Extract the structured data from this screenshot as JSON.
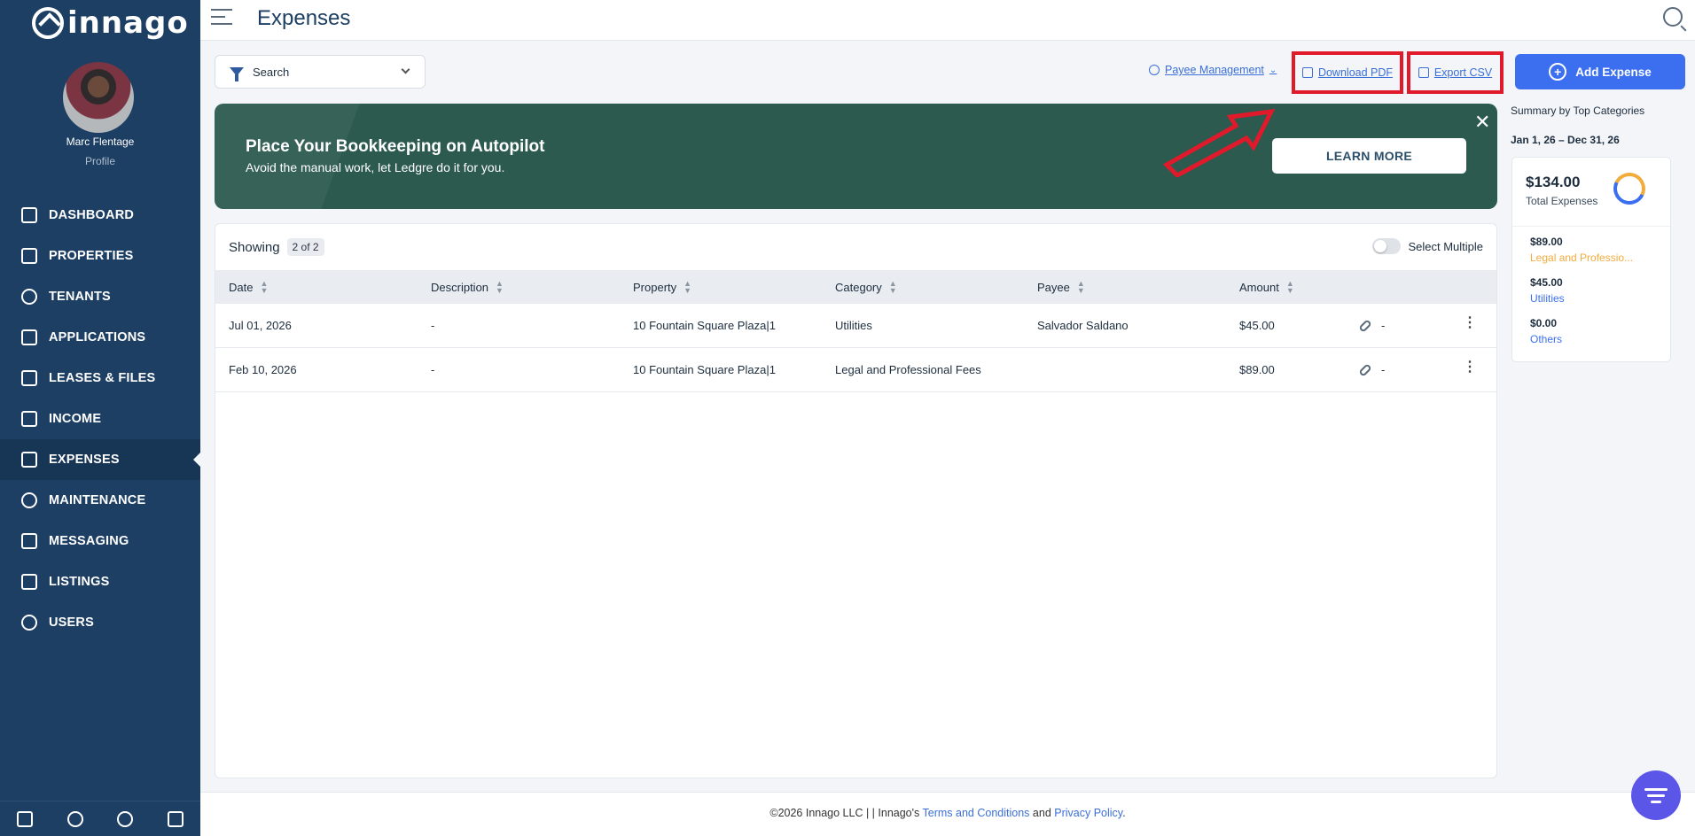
{
  "brand": {
    "name": "innago"
  },
  "user": {
    "name": "Marc Flentage",
    "profile_label": "Profile"
  },
  "sidebar": {
    "items": [
      {
        "label": "DASHBOARD",
        "icon": "dashboard-icon"
      },
      {
        "label": "PROPERTIES",
        "icon": "building-icon"
      },
      {
        "label": "TENANTS",
        "icon": "people-icon"
      },
      {
        "label": "APPLICATIONS",
        "icon": "application-icon"
      },
      {
        "label": "LEASES & FILES",
        "icon": "document-icon"
      },
      {
        "label": "INCOME",
        "icon": "income-icon"
      },
      {
        "label": "EXPENSES",
        "icon": "wallet-icon",
        "active": true
      },
      {
        "label": "MAINTENANCE",
        "icon": "wrench-icon"
      },
      {
        "label": "MESSAGING",
        "icon": "message-icon"
      },
      {
        "label": "LISTINGS",
        "icon": "listing-icon"
      },
      {
        "label": "USERS",
        "icon": "user-icon"
      }
    ]
  },
  "header": {
    "title": "Expenses"
  },
  "toolbar": {
    "search_label": "Search",
    "payee_management": "Payee Management",
    "download_pdf": "Download PDF",
    "export_csv": "Export CSV",
    "add_expense": "Add Expense"
  },
  "banner": {
    "title": "Place Your Bookkeeping on Autopilot",
    "subtitle": "Avoid the manual work, let Ledgre do it for you.",
    "button": "LEARN MORE",
    "close": "✕"
  },
  "table": {
    "showing_label": "Showing",
    "count": "2 of 2",
    "select_multiple": "Select Multiple",
    "columns": [
      "Date",
      "Description",
      "Property",
      "Category",
      "Payee",
      "Amount"
    ],
    "rows": [
      {
        "date": "Jul 01, 2026",
        "description": "-",
        "property": "10 Fountain Square Plaza|1",
        "category": "Utilities",
        "payee": "Salvador Saldano",
        "amount": "$45.00",
        "attachment": "-"
      },
      {
        "date": "Feb 10, 2026",
        "description": "-",
        "property": "10 Fountain Square Plaza|1",
        "category": "Legal and Professional Fees",
        "payee": "",
        "amount": "$89.00",
        "attachment": "-"
      }
    ]
  },
  "summary": {
    "title": "Summary by Top Categories",
    "range": "Jan 1, 26 – Dec 31, 26",
    "total_amount": "$134.00",
    "total_label": "Total Expenses",
    "items": [
      {
        "amount": "$89.00",
        "category": "Legal and Professio...",
        "color": "#f2ac3c"
      },
      {
        "amount": "$45.00",
        "category": "Utilities",
        "color": "#3b6ff0"
      },
      {
        "amount": "$0.00",
        "category": "Others",
        "color": "#3b6ff0"
      }
    ]
  },
  "footer": {
    "prefix": "©2026 Innago LLC | | Innago's",
    "terms": "Terms and Conditions",
    "and": "and",
    "privacy": "Privacy Policy",
    "suffix": "."
  },
  "colors": {
    "sidebar": "#1d3f63",
    "accent": "#3b6ff0",
    "banner": "#2c5a4f",
    "highlight": "#e01a2b"
  }
}
